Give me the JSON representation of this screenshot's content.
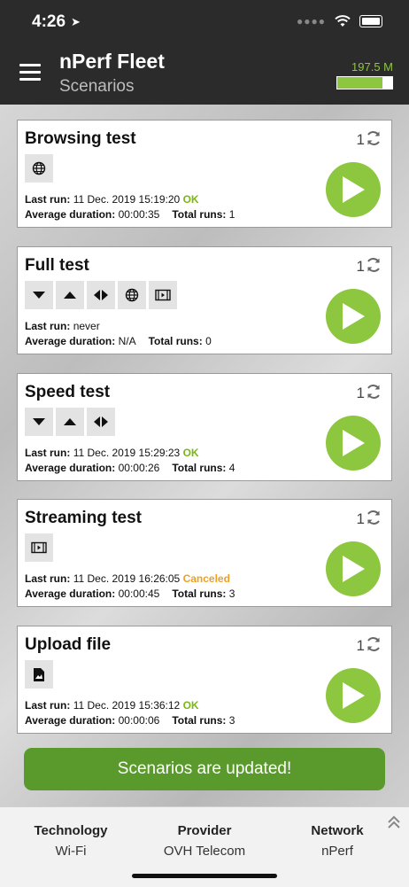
{
  "status_bar": {
    "time": "4:26"
  },
  "app": {
    "title": "nPerf Fleet",
    "subtitle": "Scenarios",
    "data_usage": "197.5 M",
    "data_usage_fraction": 0.83
  },
  "labels": {
    "last_run": "Last run:",
    "average_duration": "Average duration:",
    "total_runs": "Total runs:"
  },
  "scenarios": [
    {
      "title": "Browsing test",
      "count": "1",
      "icons": [
        "globe-icon"
      ],
      "last_run": "11 Dec. 2019 15:19:20",
      "status": "OK",
      "status_color": "#7cb518",
      "avg_duration": "00:00:35",
      "total_runs": "1"
    },
    {
      "title": "Full test",
      "count": "1",
      "icons": [
        "download-icon",
        "upload-icon",
        "latency-icon",
        "globe-icon",
        "video-icon"
      ],
      "last_run": "never",
      "status": "",
      "avg_duration": "N/A",
      "total_runs": "0"
    },
    {
      "title": "Speed test",
      "count": "1",
      "icons": [
        "download-icon",
        "upload-icon",
        "latency-icon"
      ],
      "last_run": "11 Dec. 2019 15:29:23",
      "status": "OK",
      "status_color": "#7cb518",
      "avg_duration": "00:00:26",
      "total_runs": "4"
    },
    {
      "title": "Streaming test",
      "count": "1",
      "icons": [
        "video-icon"
      ],
      "last_run": "11 Dec. 2019 16:26:05",
      "status": "Canceled",
      "status_color": "#f0a020",
      "avg_duration": "00:00:45",
      "total_runs": "3"
    },
    {
      "title": "Upload file",
      "count": "1",
      "icons": [
        "file-icon"
      ],
      "last_run": "11 Dec. 2019 15:36:12",
      "status": "OK",
      "status_color": "#7cb518",
      "avg_duration": "00:00:06",
      "total_runs": "3"
    }
  ],
  "toast": "Scenarios are updated!",
  "footer": {
    "technology_label": "Technology",
    "technology_value": "Wi-Fi",
    "provider_label": "Provider",
    "provider_value": "OVH Telecom",
    "network_label": "Network",
    "network_value": "nPerf"
  },
  "colors": {
    "accent": "#8dc63f",
    "ok": "#7cb518",
    "canceled": "#f0a020",
    "toast": "#5a9a2c"
  }
}
